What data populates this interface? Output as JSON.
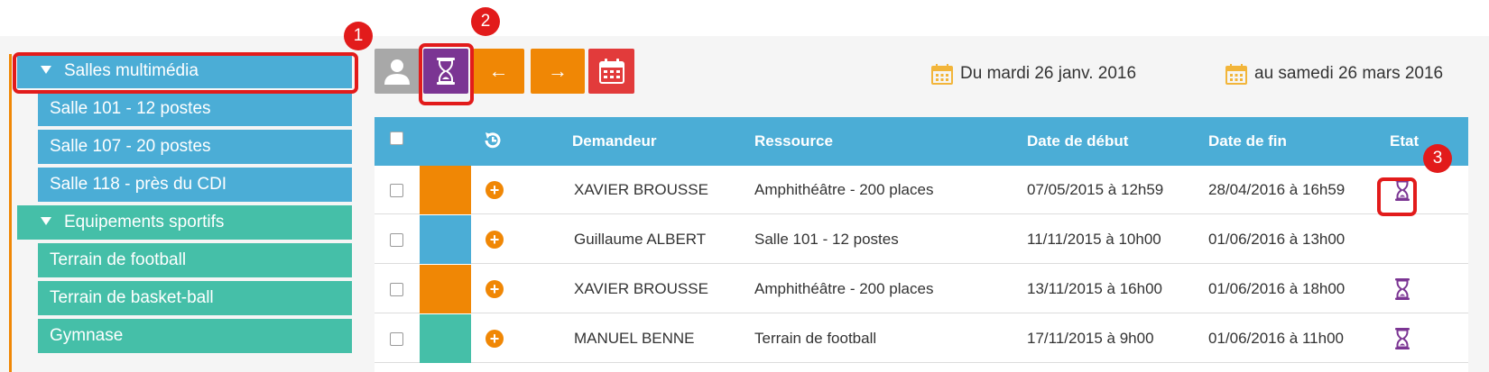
{
  "sidebar": {
    "groups": [
      {
        "label": "Salles multimédia",
        "items": [
          "Salle 101 - 12 postes",
          "Salle 107 - 20 postes",
          "Salle 118 - près du CDI"
        ]
      },
      {
        "label": "Equipements sportifs",
        "items": [
          "Terrain de football",
          "Terrain de basket-ball",
          "Gymnase"
        ]
      }
    ]
  },
  "toolbar": {
    "prev_label": "←",
    "next_label": "→",
    "date_from": "Du mardi 26 janv. 2016",
    "date_to": "au samedi 26 mars 2016"
  },
  "table": {
    "headers": {
      "requester": "Demandeur",
      "resource": "Ressource",
      "start": "Date de début",
      "end": "Date de fin",
      "status": "Etat"
    },
    "rows": [
      {
        "color": "#f08705",
        "requester": "XAVIER BROUSSE",
        "resource": "Amphithéâtre - 200 places",
        "start": "07/05/2015 à 12h59",
        "end": "28/04/2016 à 16h59",
        "pending": true
      },
      {
        "color": "#4badd6",
        "requester": "Guillaume ALBERT",
        "resource": "Salle 101 - 12 postes",
        "start": "11/11/2015 à 10h00",
        "end": "01/06/2016 à 13h00",
        "pending": false
      },
      {
        "color": "#f08705",
        "requester": "XAVIER BROUSSE",
        "resource": "Amphithéâtre - 200 places",
        "start": "13/11/2015 à 16h00",
        "end": "01/06/2016 à 18h00",
        "pending": true
      },
      {
        "color": "#45bfa8",
        "requester": "MANUEL BENNE",
        "resource": "Terrain de football",
        "start": "17/11/2015 à 9h00",
        "end": "01/06/2016 à 11h00",
        "pending": true
      }
    ]
  },
  "annotations": [
    "1",
    "2",
    "3"
  ],
  "colors": {
    "blue": "#4badd6",
    "teal": "#45bfa8",
    "orange": "#f08705",
    "purple": "#7b3593",
    "red": "#e23b3b",
    "gray": "#a8a8a8",
    "highlight": "#e21b1b"
  },
  "icons": {
    "user_button": "user-icon",
    "pending_button": "hourglass-icon",
    "calendar_button": "calendar-icon",
    "refresh_header": "refresh-icon",
    "add": "plus-circle-icon",
    "status_pending": "hourglass-icon"
  }
}
